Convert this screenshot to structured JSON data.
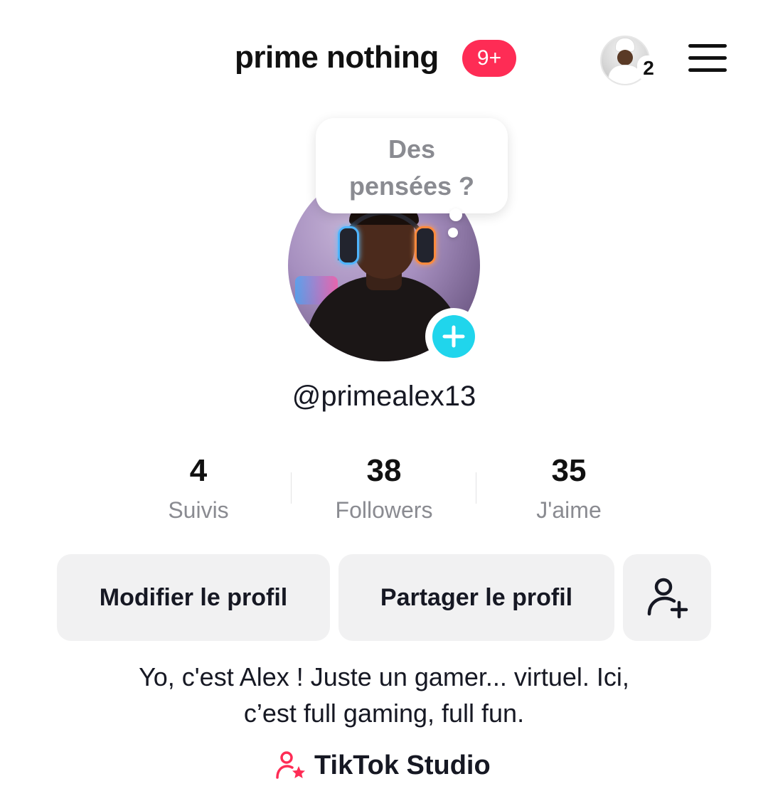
{
  "header": {
    "title": "prime nothing",
    "notification_badge": "9+",
    "account_switch_count": "2"
  },
  "thought_bubble": {
    "line1": "Des",
    "line2": "pensées ?"
  },
  "profile": {
    "handle": "@primealex13"
  },
  "stats": [
    {
      "value": "4",
      "label": "Suivis"
    },
    {
      "value": "38",
      "label": "Followers"
    },
    {
      "value": "35",
      "label": "J'aime"
    }
  ],
  "actions": {
    "edit_label": "Modifier le profil",
    "share_label": "Partager le profil"
  },
  "bio": {
    "line1": "Yo, c'est Alex ! Juste un gamer... virtuel. Ici,",
    "line2": "c’est full gaming, full fun."
  },
  "studio": {
    "label": "TikTok Studio"
  },
  "colors": {
    "accent": "#fe2c55",
    "story_add": "#20d5ec",
    "button_bg": "#f1f1f2",
    "muted_text": "#8a8b91"
  },
  "icons": {
    "menu": "hamburger-icon",
    "add_story": "plus-icon",
    "add_friend": "add-user-icon",
    "studio": "creator-star-icon"
  }
}
